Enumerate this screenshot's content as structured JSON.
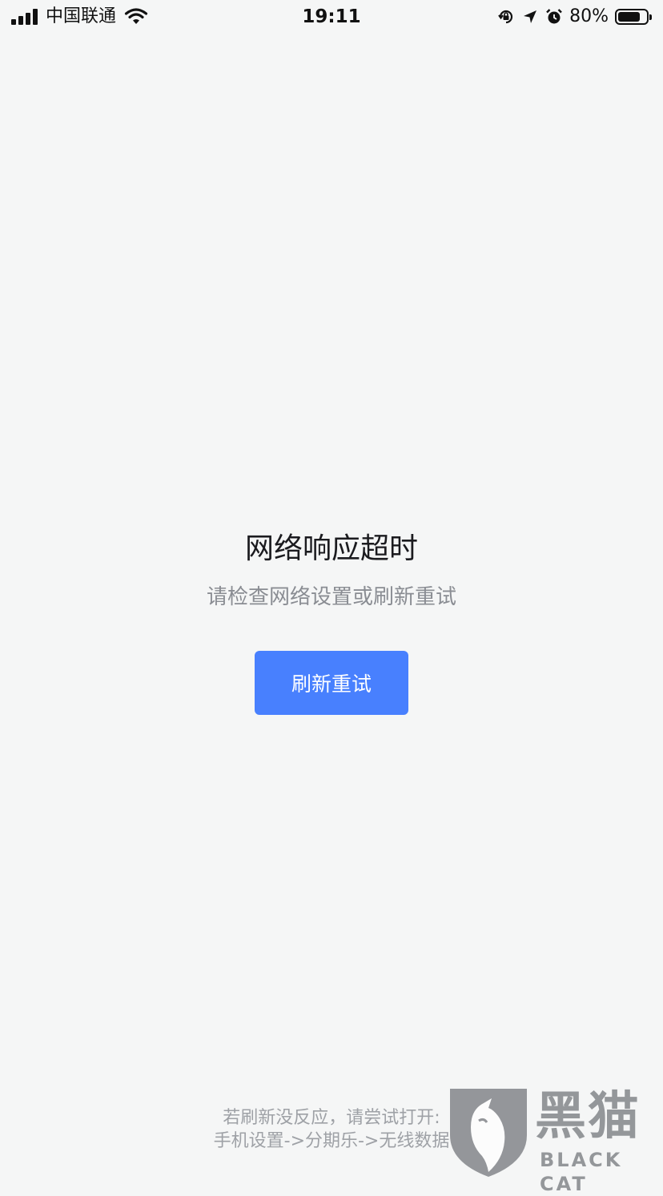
{
  "status_bar": {
    "carrier": "中国联通",
    "time": "19:11",
    "battery_percent_label": "80%",
    "battery_level": 0.8,
    "icons": [
      "signal-icon",
      "wifi-icon",
      "orientation-lock-icon",
      "location-arrow-icon",
      "alarm-icon",
      "battery-icon"
    ]
  },
  "error": {
    "title": "网络响应超时",
    "subtitle": "请检查网络设置或刷新重试",
    "retry_label": "刷新重试"
  },
  "footer": {
    "line1": "若刷新没反应，请尝试打开:",
    "line2": "手机设置->分期乐->无线数据"
  },
  "watermark": {
    "text_cn": "黑猫",
    "text_en": "BLACK CAT"
  },
  "colors": {
    "background": "#f5f6f6",
    "accent": "#4880fe",
    "title_text": "#1b1b1f",
    "secondary_text": "#8a8d93",
    "hint_text": "#9ea1a6"
  }
}
